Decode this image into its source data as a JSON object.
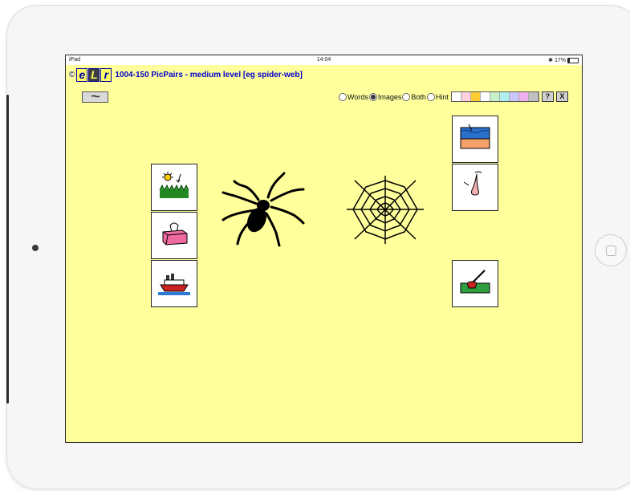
{
  "status_bar": {
    "device": "iPad",
    "time": "14:04",
    "battery": "17%"
  },
  "header": {
    "copyright": "©",
    "logo_letters": [
      "e",
      "L",
      "r"
    ],
    "title": "1004-150 PicPairs - medium level [eg spider-web]"
  },
  "controls": {
    "media_label": "⏮ ⏭",
    "modes": [
      {
        "label": "Words",
        "selected": false
      },
      {
        "label": "Images",
        "selected": true
      },
      {
        "label": "Both",
        "selected": false
      },
      {
        "label": "Hint",
        "selected": false
      }
    ],
    "swatches": [
      "#ffffff",
      "#ffd0e0",
      "#ffcc33",
      "#ffffff",
      "#c8f0c8",
      "#aef0f0",
      "#c8c8ff",
      "#f0b0f0",
      "#c0c0c0"
    ],
    "help_label": "?",
    "close_label": "X"
  },
  "cards_left": [
    "sunshine-grass-picture",
    "tissue-box-picture",
    "ship-picture"
  ],
  "cards_right": [
    "sea-beach-picture",
    "nose-picture",
    "pen-grass-picture"
  ],
  "big_images": [
    "spider-picture",
    "spider-web-picture"
  ]
}
